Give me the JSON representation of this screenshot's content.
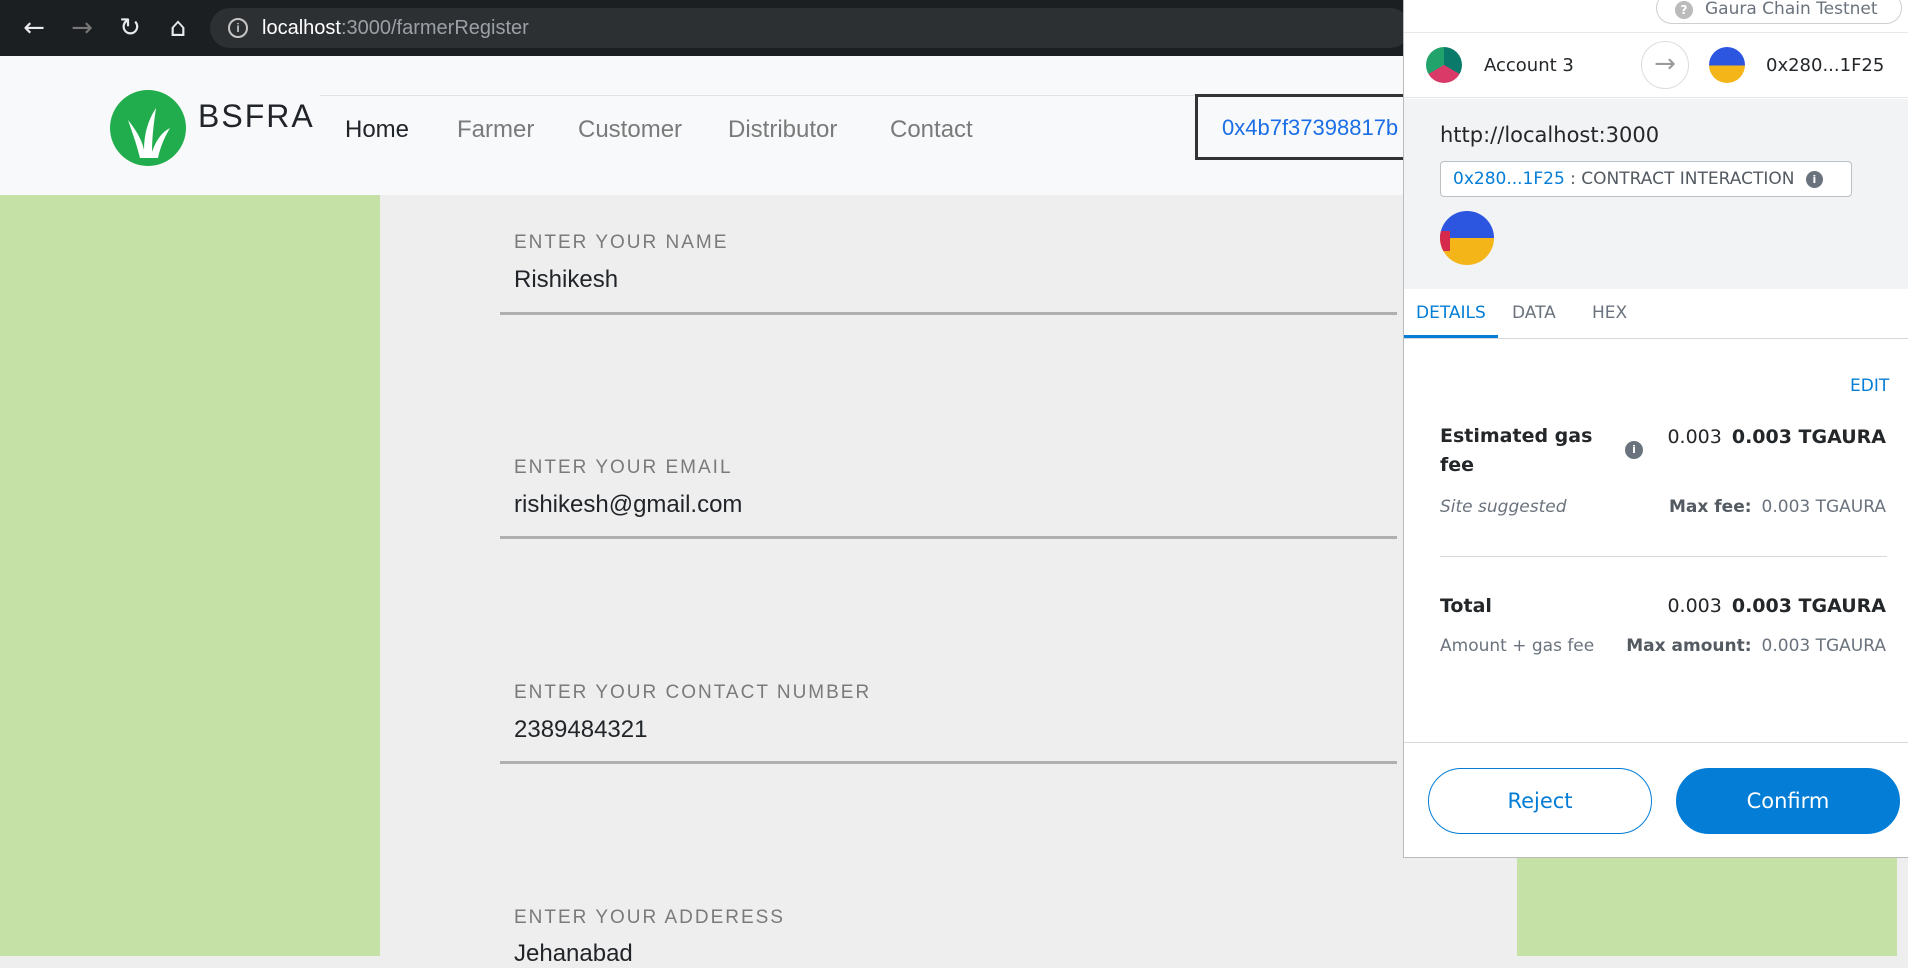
{
  "browser": {
    "url_host": "localhost",
    "url_path": ":3000/farmerRegister"
  },
  "site": {
    "brand": "BSFRA",
    "nav": [
      "Home",
      "Farmer",
      "Customer",
      "Distributor",
      "Contact"
    ],
    "wallet_address": "0x4b7f37398817b"
  },
  "form": {
    "fields": [
      {
        "label": "ENTER YOUR NAME",
        "value": "Rishikesh"
      },
      {
        "label": "ENTER YOUR EMAIL",
        "value": "rishikesh@gmail.com"
      },
      {
        "label": "ENTER YOUR CONTACT NUMBER",
        "value": "2389484321"
      },
      {
        "label": "ENTER YOUR ADDERESS",
        "value": "Jehanabad"
      }
    ]
  },
  "metamask": {
    "network": "Gaura Chain Testnet",
    "from_account": "Account 3",
    "to_address": "0x280...1F25",
    "origin": "http://localhost:3000",
    "contract_address": "0x280...1F25",
    "contract_label": ": CONTRACT INTERACTION",
    "tabs": [
      "DETAILS",
      "DATA",
      "HEX"
    ],
    "edit": "EDIT",
    "gas": {
      "heading": "Estimated gas fee",
      "value": "0.003",
      "value_bold": "0.003 TGAURA",
      "sub": "Site suggested",
      "max_label": "Max fee:",
      "max_value": "0.003 TGAURA"
    },
    "total": {
      "heading": "Total",
      "value": "0.003",
      "value_bold": "0.003 TGAURA",
      "sub": "Amount + gas fee",
      "max_label": "Max amount:",
      "max_value": "0.003 TGAURA"
    },
    "reject": "Reject",
    "confirm": "Confirm"
  }
}
